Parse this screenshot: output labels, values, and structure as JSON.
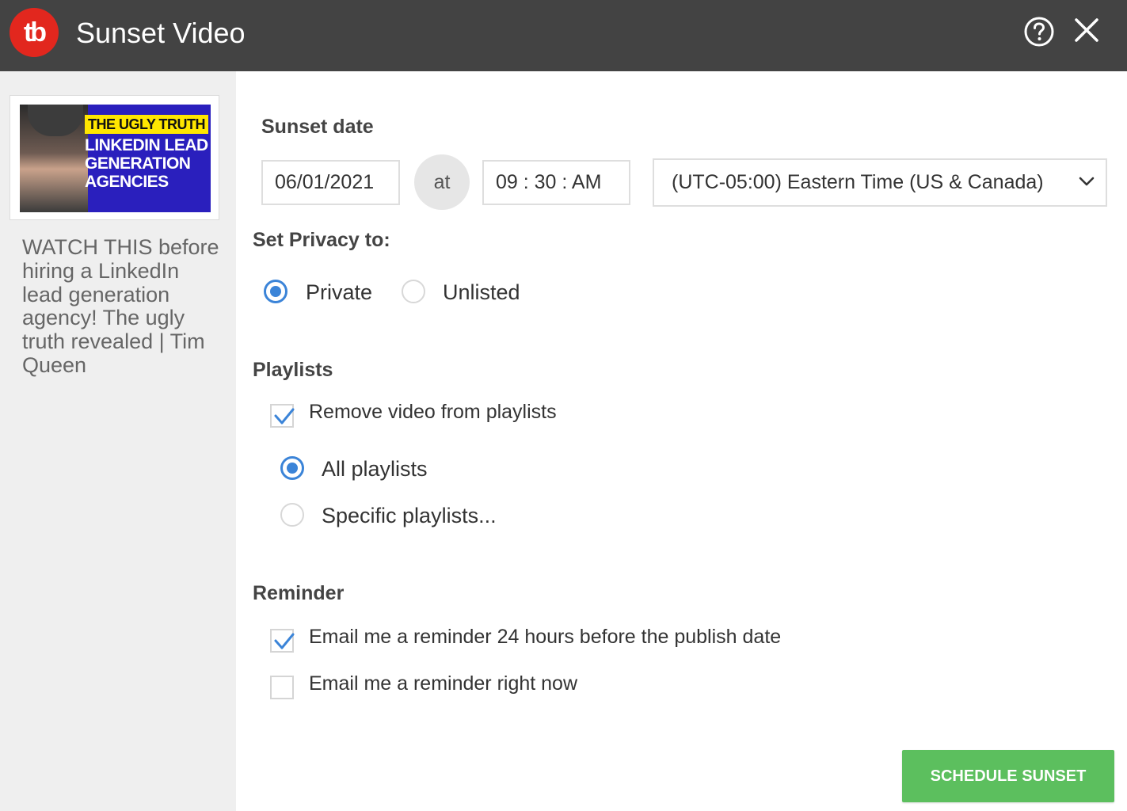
{
  "window": {
    "logo_text": "tb",
    "title": "Sunset Video"
  },
  "sidebar": {
    "thumbnail": {
      "tag": "THE UGLY TRUTH",
      "headline_lines": [
        "LINKEDIN LEAD",
        "GENERATION",
        "AGENCIES"
      ]
    },
    "video_title": "WATCH THIS before hiring a LinkedIn lead generation agency! The ugly truth revealed | Tim Queen"
  },
  "sunset": {
    "label": "Sunset date",
    "date": "06/01/2021",
    "at": "at",
    "time": "09 : 30 : AM",
    "timezone": "(UTC-05:00) Eastern Time (US & Canada)"
  },
  "privacy": {
    "label": "Set Privacy to:",
    "options": [
      {
        "label": "Private",
        "selected": true
      },
      {
        "label": "Unlisted",
        "selected": false
      }
    ]
  },
  "playlists": {
    "label": "Playlists",
    "remove_label": "Remove video from playlists",
    "remove_checked": true,
    "options": [
      {
        "label": "All playlists",
        "selected": true
      },
      {
        "label": "Specific playlists...",
        "selected": false
      }
    ]
  },
  "reminder": {
    "label": "Reminder",
    "items": [
      {
        "label": "Email me a reminder 24 hours before the publish date",
        "checked": true
      },
      {
        "label": "Email me a reminder right now",
        "checked": false
      }
    ]
  },
  "actions": {
    "schedule_label": "SCHEDULE SUNSET"
  },
  "colors": {
    "titlebar": "#434343",
    "logo": "#e2271e",
    "accent_blue": "#3b84d8",
    "button_green": "#5cbf5e",
    "sidebar_bg": "#efefef"
  }
}
